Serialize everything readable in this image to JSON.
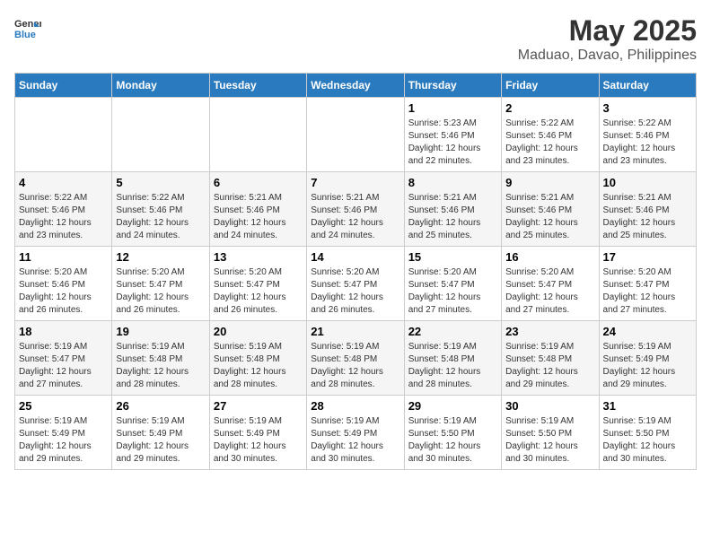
{
  "header": {
    "logo_line1": "General",
    "logo_line2": "Blue",
    "title": "May 2025",
    "subtitle": "Maduao, Davao, Philippines"
  },
  "weekdays": [
    "Sunday",
    "Monday",
    "Tuesday",
    "Wednesday",
    "Thursday",
    "Friday",
    "Saturday"
  ],
  "weeks": [
    [
      {
        "day": "",
        "info": ""
      },
      {
        "day": "",
        "info": ""
      },
      {
        "day": "",
        "info": ""
      },
      {
        "day": "",
        "info": ""
      },
      {
        "day": "1",
        "info": "Sunrise: 5:23 AM\nSunset: 5:46 PM\nDaylight: 12 hours\nand 22 minutes."
      },
      {
        "day": "2",
        "info": "Sunrise: 5:22 AM\nSunset: 5:46 PM\nDaylight: 12 hours\nand 23 minutes."
      },
      {
        "day": "3",
        "info": "Sunrise: 5:22 AM\nSunset: 5:46 PM\nDaylight: 12 hours\nand 23 minutes."
      }
    ],
    [
      {
        "day": "4",
        "info": "Sunrise: 5:22 AM\nSunset: 5:46 PM\nDaylight: 12 hours\nand 23 minutes."
      },
      {
        "day": "5",
        "info": "Sunrise: 5:22 AM\nSunset: 5:46 PM\nDaylight: 12 hours\nand 24 minutes."
      },
      {
        "day": "6",
        "info": "Sunrise: 5:21 AM\nSunset: 5:46 PM\nDaylight: 12 hours\nand 24 minutes."
      },
      {
        "day": "7",
        "info": "Sunrise: 5:21 AM\nSunset: 5:46 PM\nDaylight: 12 hours\nand 24 minutes."
      },
      {
        "day": "8",
        "info": "Sunrise: 5:21 AM\nSunset: 5:46 PM\nDaylight: 12 hours\nand 25 minutes."
      },
      {
        "day": "9",
        "info": "Sunrise: 5:21 AM\nSunset: 5:46 PM\nDaylight: 12 hours\nand 25 minutes."
      },
      {
        "day": "10",
        "info": "Sunrise: 5:21 AM\nSunset: 5:46 PM\nDaylight: 12 hours\nand 25 minutes."
      }
    ],
    [
      {
        "day": "11",
        "info": "Sunrise: 5:20 AM\nSunset: 5:46 PM\nDaylight: 12 hours\nand 26 minutes."
      },
      {
        "day": "12",
        "info": "Sunrise: 5:20 AM\nSunset: 5:47 PM\nDaylight: 12 hours\nand 26 minutes."
      },
      {
        "day": "13",
        "info": "Sunrise: 5:20 AM\nSunset: 5:47 PM\nDaylight: 12 hours\nand 26 minutes."
      },
      {
        "day": "14",
        "info": "Sunrise: 5:20 AM\nSunset: 5:47 PM\nDaylight: 12 hours\nand 26 minutes."
      },
      {
        "day": "15",
        "info": "Sunrise: 5:20 AM\nSunset: 5:47 PM\nDaylight: 12 hours\nand 27 minutes."
      },
      {
        "day": "16",
        "info": "Sunrise: 5:20 AM\nSunset: 5:47 PM\nDaylight: 12 hours\nand 27 minutes."
      },
      {
        "day": "17",
        "info": "Sunrise: 5:20 AM\nSunset: 5:47 PM\nDaylight: 12 hours\nand 27 minutes."
      }
    ],
    [
      {
        "day": "18",
        "info": "Sunrise: 5:19 AM\nSunset: 5:47 PM\nDaylight: 12 hours\nand 27 minutes."
      },
      {
        "day": "19",
        "info": "Sunrise: 5:19 AM\nSunset: 5:48 PM\nDaylight: 12 hours\nand 28 minutes."
      },
      {
        "day": "20",
        "info": "Sunrise: 5:19 AM\nSunset: 5:48 PM\nDaylight: 12 hours\nand 28 minutes."
      },
      {
        "day": "21",
        "info": "Sunrise: 5:19 AM\nSunset: 5:48 PM\nDaylight: 12 hours\nand 28 minutes."
      },
      {
        "day": "22",
        "info": "Sunrise: 5:19 AM\nSunset: 5:48 PM\nDaylight: 12 hours\nand 28 minutes."
      },
      {
        "day": "23",
        "info": "Sunrise: 5:19 AM\nSunset: 5:48 PM\nDaylight: 12 hours\nand 29 minutes."
      },
      {
        "day": "24",
        "info": "Sunrise: 5:19 AM\nSunset: 5:49 PM\nDaylight: 12 hours\nand 29 minutes."
      }
    ],
    [
      {
        "day": "25",
        "info": "Sunrise: 5:19 AM\nSunset: 5:49 PM\nDaylight: 12 hours\nand 29 minutes."
      },
      {
        "day": "26",
        "info": "Sunrise: 5:19 AM\nSunset: 5:49 PM\nDaylight: 12 hours\nand 29 minutes."
      },
      {
        "day": "27",
        "info": "Sunrise: 5:19 AM\nSunset: 5:49 PM\nDaylight: 12 hours\nand 30 minutes."
      },
      {
        "day": "28",
        "info": "Sunrise: 5:19 AM\nSunset: 5:49 PM\nDaylight: 12 hours\nand 30 minutes."
      },
      {
        "day": "29",
        "info": "Sunrise: 5:19 AM\nSunset: 5:50 PM\nDaylight: 12 hours\nand 30 minutes."
      },
      {
        "day": "30",
        "info": "Sunrise: 5:19 AM\nSunset: 5:50 PM\nDaylight: 12 hours\nand 30 minutes."
      },
      {
        "day": "31",
        "info": "Sunrise: 5:19 AM\nSunset: 5:50 PM\nDaylight: 12 hours\nand 30 minutes."
      }
    ]
  ]
}
